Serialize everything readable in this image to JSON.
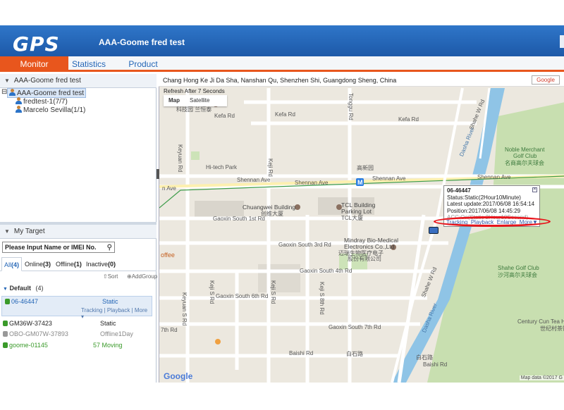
{
  "header": {
    "logo_text": "GPS",
    "app_title": "AAA-Goome fred test"
  },
  "tabs": [
    {
      "label": "Monitor",
      "active": true
    },
    {
      "label": "Statistics",
      "active": false
    },
    {
      "label": "Product",
      "active": false
    }
  ],
  "tree_panel": {
    "title": "AAA-Goome fred test",
    "root": "AAA-Goome fred test",
    "children": [
      "fredtest-1(7/7)",
      "Marcelo Sevilla(1/1)"
    ]
  },
  "target_panel": {
    "title": "My Target",
    "search_placeholder": "Please Input Name or IMEI No.",
    "filters": [
      {
        "label": "All",
        "count": "(4)"
      },
      {
        "label": "Online",
        "count": "(3)"
      },
      {
        "label": "Offline",
        "count": "(1)"
      },
      {
        "label": "Inactive",
        "count": "(0)"
      }
    ],
    "sort_label": "Sort",
    "add_group_label": "AddGroup",
    "group": {
      "name": "Default",
      "count": "(4)"
    },
    "devices": [
      {
        "name": "06-46447",
        "status": "Static",
        "links": "Tracking | Playback | More ▾",
        "color": "#3a9a2a"
      },
      {
        "name": "GM36W-37423",
        "status": "Static",
        "color": "#3a9a2a"
      },
      {
        "name": "OBO-GM07W-37893",
        "status": "Offline1Day",
        "color": "#999999"
      },
      {
        "name": "goome-01145",
        "status": "57 Moving",
        "color": "#3a9a2a"
      }
    ]
  },
  "map": {
    "address": "Chang Hong Ke Ji Da Sha, Nanshan Qu, Shenzhen Shi, Guangdong Sheng, China",
    "google_button": "Google",
    "refresh_text": "Refresh After 7 Seconds",
    "map_types": [
      "Map",
      "Satellite"
    ],
    "labels": {
      "kefa1": "Kefa Rd",
      "kefa2": "Kefa Rd",
      "kefa3": "Kefa Rd",
      "tonggu": "Tonggu Rd",
      "shahe": "Shahe W Rd",
      "dasha": "Dasha River",
      "noble": "Noble Merchant",
      "noble2": "Golf Club",
      "noble3": "名商高尔夫球会",
      "keyuan": "Keyuan Rd",
      "keji": "Keji Rd",
      "hitech": "Hi-tech Park",
      "hitech_cn": "高新园",
      "shennan1": "Shennan Ave",
      "shennan2": "Shennan Ave",
      "shennan3": "Shennan Ave",
      "shennan4": "Shennan Ave",
      "chuangwei": "Chuangwei Building",
      "chuangwei_cn": "创维大厦",
      "tcl": "TCL Building",
      "tcl2": "Parking Lot",
      "tcl_cn": "TCL大厦",
      "gaoxin1": "Gaoxin South 1st Rd",
      "gaoxin3": "Gaoxin South 3rd Rd",
      "mindray": "Mindray Bio-Medical",
      "mindray2": "Electronics Co.,Ltd",
      "mindray_cn": "迈瑞生物医疗电子",
      "mindray_cn2": "股份有限公司",
      "gaoxin4": "Gaoxin South 4th Rd",
      "gaoxin6": "Gaoxin South 6th Rd",
      "gaoxin7": "Gaoxin South 7th Rd",
      "keyuan_s": "Keyuan S Rd",
      "keji_s": "Keji S Rd",
      "keji_s2": "Keji S Rd",
      "keji_s8": "Keji S 8th Rd",
      "shahe_golf": "Shahe Golf Club",
      "shahe_golf_cn": "沙河高尔夫球会",
      "century": "Century Cun Tea House",
      "century_cn": "世纪村茶馆",
      "baishi1": "Baishi Rd",
      "baishi2": "Baishi Rd",
      "baishi_cn": "白石路",
      "baishi_cn2": "白石路",
      "ave7": "7th Rd",
      "ave_left": "n Ave",
      "offee": "offee",
      "sanchen": "科技园 兰恒泰"
    },
    "popup": {
      "title": "06-46447",
      "status": "Status:Static(2Hour10Minute)",
      "latest": "Latest update:2017/06/08 16:54:14",
      "position": "Position:2017/06/08 14:45:29",
      "acc": "ACC:On(Static 2Hour10Second)",
      "links": [
        "Tracking",
        "Playback",
        "Enlarge",
        "More▼"
      ]
    },
    "google_logo": "Google",
    "map_data": "Map data ©2017 G",
    "highlight_color": "#e8141b"
  }
}
